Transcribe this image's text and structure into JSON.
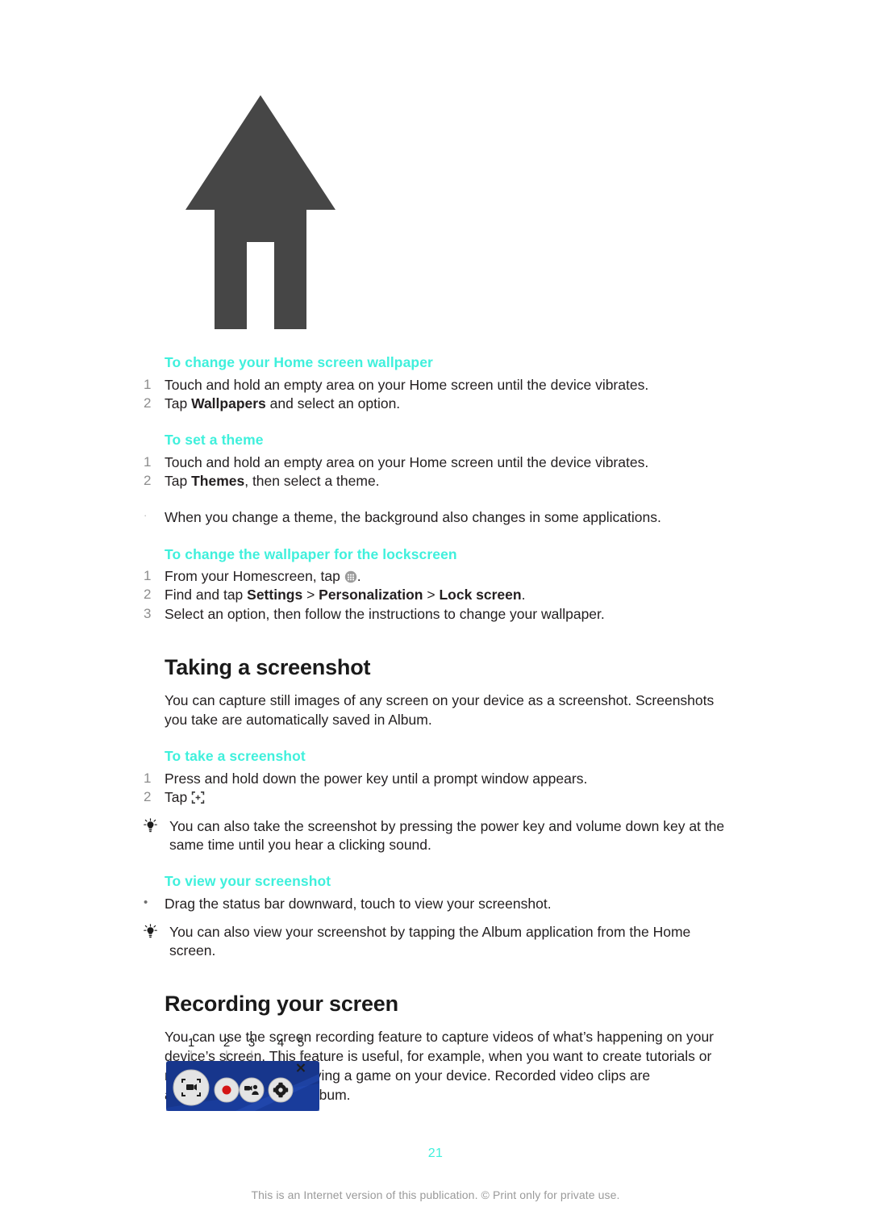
{
  "document": {
    "page_number": "21",
    "footer_note": "This is an Internet version of this publication. © Print only for private use.",
    "accent_color": "#3FF0DC",
    "body_color": "#231f20",
    "toolbar_blue": "#17368C"
  },
  "hero": {
    "icon_name": "up-arrow-home-glyph",
    "color": "#464646"
  },
  "sections": [
    {
      "heading": "To change your Home screen wallpaper",
      "steps": [
        {
          "num": "1",
          "text": "Touch and hold an empty area on your Home screen until the device vibrates."
        },
        {
          "num": "2",
          "text_pre": "Tap ",
          "bold": "Wallpapers",
          "text_post": " and select an option."
        }
      ]
    },
    {
      "heading": "To set a theme",
      "steps": [
        {
          "num": "1",
          "text": "Touch and hold an empty area on your Home screen until the device vibrates."
        },
        {
          "num": "2",
          "text_pre": "Tap ",
          "bold": "Themes",
          "text_post": ", then select a theme."
        }
      ],
      "note": {
        "marker": "·",
        "text": "When you change a theme, the background also changes in some applications."
      }
    },
    {
      "heading": "To change the wallpaper for the lockscreen",
      "steps": [
        {
          "num": "1",
          "text_pre": "From your Homescreen, tap ",
          "icon": "app-drawer-icon",
          "text_post": "."
        },
        {
          "num": "2",
          "text_pre": "Find and tap ",
          "bold": "Settings",
          "sep1": " > ",
          "bold2": "Personalization",
          "sep2": " > ",
          "bold3": "Lock screen",
          "text_post": "."
        },
        {
          "num": "3",
          "text": "Select an option, then follow the instructions to change your wallpaper."
        }
      ]
    }
  ],
  "taking_screenshot": {
    "title": "Taking a screenshot",
    "intro": "You can capture still images of any screen on your device as a screenshot. Screenshots you take are automatically saved in Album.",
    "sub_heading": "To take a screenshot",
    "steps": [
      {
        "num": "1",
        "text": "Press and hold down the power key until a prompt window appears."
      },
      {
        "num": "2",
        "text_pre": "Tap ",
        "icon": "screenshot-crosshair-icon",
        "text_post": ""
      }
    ],
    "tip": "You can also take the screenshot by pressing the power key and volume down key at the same time until you hear a clicking sound.",
    "view_heading": "To view your screenshot",
    "view_bullet": {
      "marker": "•",
      "text": "Drag the status bar downward, touch to view your screenshot."
    },
    "view_tip": "You can also view your screenshot by tapping the Album application from the Home screen."
  },
  "recording_screen": {
    "title": "Recording your screen",
    "intro": "You can use the screen recording feature to capture videos of what’s happening on your device’s screen. This feature is useful, for example, when you want to create tutorials or record videos of you playing a game on your device. Recorded video clips are automatically saved in Album.",
    "toolbar": {
      "background_color": "#17368C",
      "callouts": [
        "1",
        "2",
        "3",
        "4",
        "5"
      ],
      "buttons": [
        {
          "number": "1",
          "icon_name": "video-viewfinder-icon",
          "label": ""
        },
        {
          "number": "2",
          "icon_name": "record-dot-icon",
          "label": ""
        },
        {
          "number": "3",
          "icon_name": "front-camera-person-icon",
          "label": ""
        },
        {
          "number": "4",
          "icon_name": "settings-gear-icon",
          "label": ""
        },
        {
          "number": "5",
          "icon_name": "close-x-icon",
          "label": ""
        }
      ]
    }
  }
}
